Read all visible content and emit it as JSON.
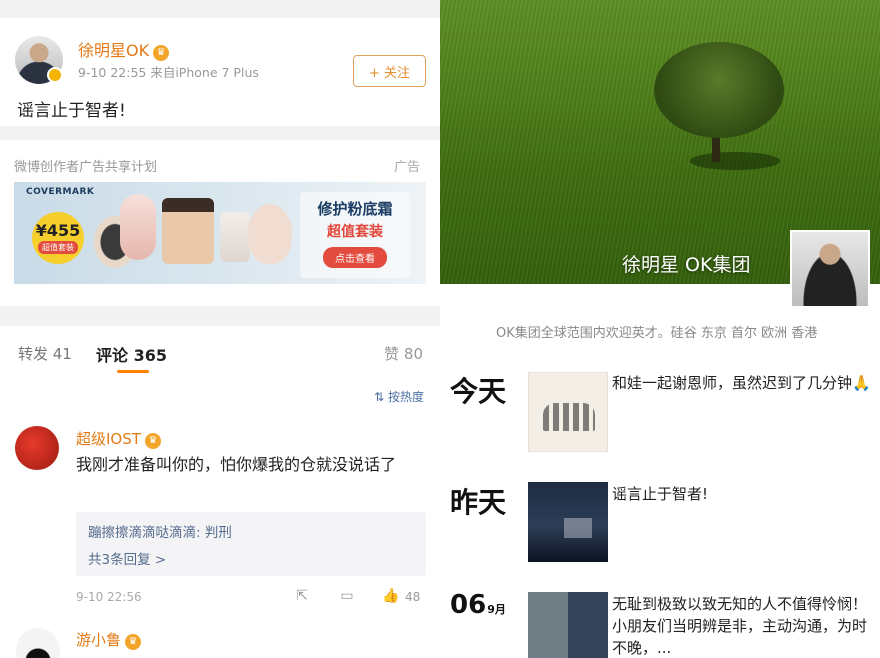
{
  "post": {
    "author": "徐明星OK",
    "meta": "9-10 22:55  来自iPhone 7 Plus",
    "follow_label": "+ 关注",
    "text": "谣言止于智者!"
  },
  "ad": {
    "label": "微博创作者广告共享计划",
    "tag": "广告",
    "brand": "COVERMARK",
    "price": "¥455",
    "price_tag": "超值套装",
    "headline": "修护粉底霜",
    "subheadline": "超值套装",
    "cta": "点击查看"
  },
  "comments": {
    "repost_tab": "转发 41",
    "comment_tab": "评论 365",
    "like_tab": "赞 80",
    "sort_label": "按热度",
    "items": [
      {
        "name": "超级IOST",
        "text": "我刚才准备叫你的，怕你爆我的仓就没说话了",
        "reply_preview": "蹦擦擦滴滴哒滴滴: 判刑",
        "reply_count": "共3条回复 >",
        "time": "9-10 22:56",
        "likes": "48"
      },
      {
        "name": "游小鲁"
      }
    ]
  },
  "profile": {
    "cover_name": "徐明星 OK集团",
    "bio": "OK集团全球范围内欢迎英才。硅谷 东京 首尔 欧洲 香港",
    "timeline": [
      {
        "day": "今天",
        "text": "和娃一起谢恩师，虽然迟到了几分钟🙏"
      },
      {
        "day": "昨天",
        "text": "谣言止于智者!"
      },
      {
        "day_num": "06",
        "month": "9月",
        "text": "无耻到极致以致无知的人不值得怜悯！小朋友们当明辨是非，主动沟通，为时不晚，..."
      }
    ]
  },
  "colors": {
    "accent": "#ff8200",
    "username": "#e37a16",
    "link": "#556c8e"
  }
}
